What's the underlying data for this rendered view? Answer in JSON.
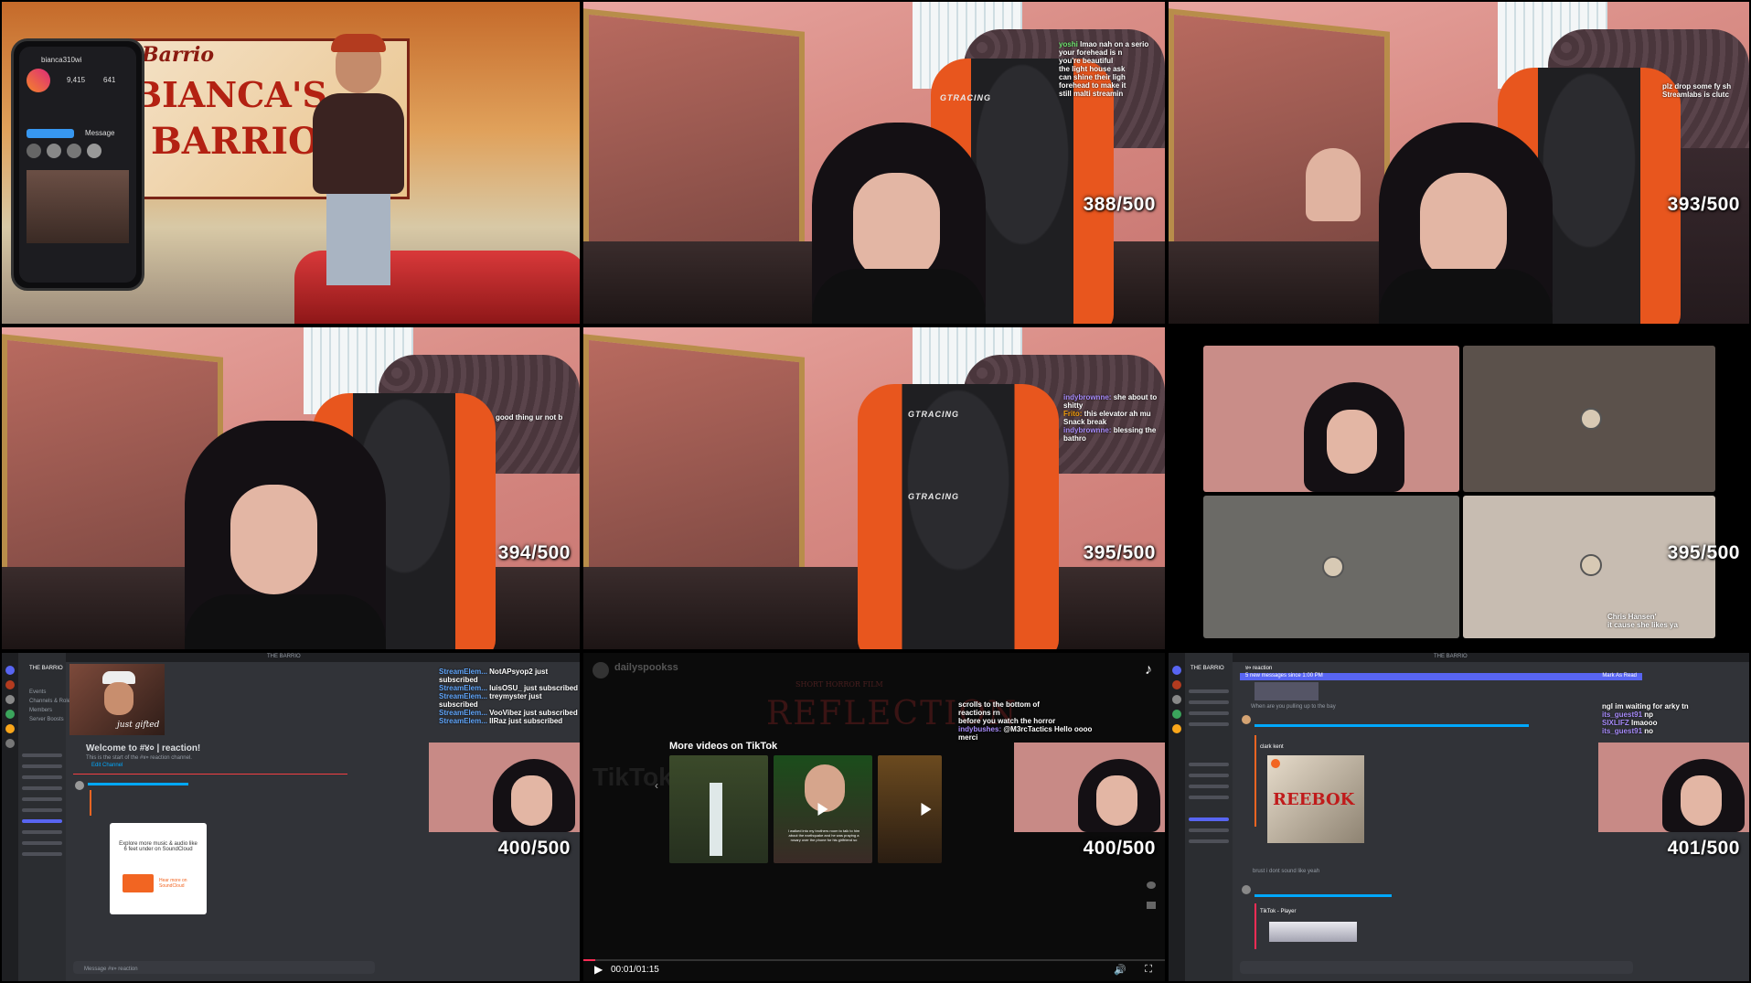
{
  "counters": {
    "c1": "388/500",
    "c2": "393/500",
    "c3": "394/500",
    "c4": "395/500",
    "c5": "395/500",
    "c6": "400/500",
    "c7": "400/500",
    "c8": "401/500"
  },
  "gta": {
    "mural_line1": "BIANCA'S",
    "mural_line2": "BARRIO",
    "mural_top": "Barrio",
    "phone_user": "bianca310wi",
    "phone_stats": [
      "9,415",
      "641"
    ],
    "phone_button": "Message"
  },
  "chair_brand": "GTRACING",
  "chats": {
    "cell2": [
      {
        "user": "yoshi",
        "msg": "lmao nah on a serio"
      },
      {
        "user": "",
        "msg": "your forehead is n"
      },
      {
        "user": "",
        "msg": "you're beautiful"
      },
      {
        "user": "",
        "msg": "the light house ask"
      },
      {
        "user": "",
        "msg": "can shine their ligh"
      },
      {
        "user": "",
        "msg": "forehead to make it"
      },
      {
        "user": "",
        "msg": "still malti streamin"
      }
    ],
    "cell3": [
      {
        "user": "",
        "msg": "plz drop some fy sh"
      },
      {
        "user": "",
        "msg": "Streamlabs is clutc"
      }
    ],
    "cell4": [
      {
        "user": "",
        "msg": "good thing ur not b"
      }
    ],
    "cell5": [
      {
        "user": "indybrownne:",
        "msg": "she about to shitty"
      },
      {
        "user": "Frito:",
        "msg": "this elevator ah mu"
      },
      {
        "user": "",
        "msg": "Snack break"
      },
      {
        "user": "indybrownne:",
        "msg": "blessing the bathro"
      }
    ],
    "cell6": [
      {
        "user": "",
        "msg": "Chris Hansen'"
      },
      {
        "user": "",
        "msg": "it cause she likes ya"
      }
    ],
    "cell7": [
      {
        "user": "StreamElem...",
        "msg": "NotAPsyop2 just subscribed"
      },
      {
        "user": "StreamElem...",
        "msg": "luisOSU_ just subscribed"
      },
      {
        "user": "StreamElem...",
        "msg": "treymyster just subscribed"
      },
      {
        "user": "StreamElem...",
        "msg": "VooVibez just subscribed"
      },
      {
        "user": "StreamElem...",
        "msg": "IIRaz just subscribed"
      }
    ],
    "cell8": [
      {
        "user": "",
        "msg": "scrolls to the bottom of"
      },
      {
        "user": "",
        "msg": "reactions rn"
      },
      {
        "user": "",
        "msg": "before you watch the horror"
      },
      {
        "user": "indybushes:",
        "msg": "@M3rcTactics Hello oooo"
      },
      {
        "user": "",
        "msg": "merci"
      }
    ],
    "cell9": [
      {
        "user": "",
        "msg": "ngl im waiting for arky tn"
      },
      {
        "user": "its_guest91",
        "msg": "np"
      },
      {
        "user": "SIXLIFZ",
        "msg": "lmaooo"
      },
      {
        "user": "its_guest91",
        "msg": "no"
      }
    ]
  },
  "discord1": {
    "server": "THE BARRIO",
    "welcome": "Welcome to #४० | reaction!",
    "welcome_sub": "This is the start of the #४० reaction channel.",
    "edit": "Edit Channel",
    "channels": [
      "Events",
      "Channels & Roles",
      "Members",
      "Server Boosts"
    ],
    "soundcloud_cta": "Explore more music & audio like 6 feet under on SoundCloud",
    "soundcloud_btn": "Hear more on SoundCloud",
    "poster_text": "just gifted",
    "input": "Message #४० reaction"
  },
  "tiktok": {
    "channel": "dailyspookss",
    "film_label": "SHORT HORROR FILM",
    "film_title": "REFLECTION",
    "more": "More videos on TikTok",
    "time": "00:01/01:15",
    "caption": "I walked into my brothers room to talk to him about the earthquake and he was praying a rosary over the phone for his girlfriend so",
    "watermark": "TikTok"
  },
  "discord2": {
    "server": "THE BARRIO",
    "channel": "४० reaction",
    "new_messages": "5 new messages since 1:00 PM",
    "mark_read": "Mark As Read",
    "msg1": "When are you pulling up to the bay",
    "link_text": "clark kent",
    "movie": "REEBOK",
    "msg2": "brust i dont sound like yeah",
    "tiktok_label": "TikTok - Player"
  }
}
